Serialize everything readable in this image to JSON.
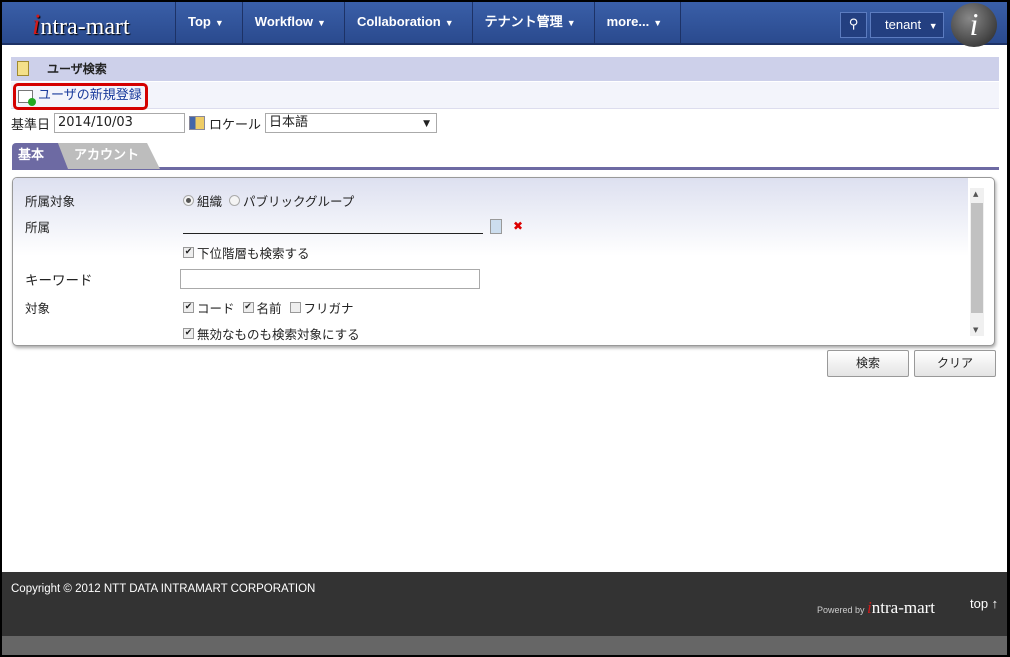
{
  "nav": {
    "logo": "intra-mart",
    "menu": [
      "Top",
      "Workflow",
      "Collaboration",
      "テナント管理",
      "more..."
    ],
    "user": "tenant"
  },
  "header": {
    "title": "ユーザ検索"
  },
  "actions": {
    "new_user": "ユーザの新規登録"
  },
  "filter": {
    "date_label": "基準日",
    "date_value": "2014/10/03",
    "locale_label": "ロケール",
    "locale_value": "日本語"
  },
  "tabs": [
    "基本",
    "アカウント"
  ],
  "form": {
    "affiliation_type_label": "所属対象",
    "radio_org": "組織",
    "radio_public": "パブリックグループ",
    "affiliation_type_selected": "組織",
    "affiliation_label": "所属",
    "affiliation_value": "",
    "include_sub": "下位階層も検索する",
    "include_sub_checked": true,
    "keyword_label": "キーワード",
    "keyword_value": "",
    "target_label": "対象",
    "target_code": "コード",
    "target_code_checked": true,
    "target_name": "名前",
    "target_name_checked": true,
    "target_kana": "フリガナ",
    "target_kana_checked": false,
    "include_invalid": "無効なものも検索対象にする",
    "include_invalid_checked": true
  },
  "buttons": {
    "search": "検索",
    "clear": "クリア"
  },
  "footer": {
    "copyright": "Copyright © 2012 NTT DATA INTRAMART CORPORATION",
    "powered": "Powered by",
    "powered_logo": "intra-mart",
    "top": "top ↑"
  },
  "colors": {
    "nav": "#2f519a",
    "header": "#cdd0ea",
    "tab_active": "#6d6aa3",
    "highlight": "#d40000",
    "footer": "#333333"
  }
}
